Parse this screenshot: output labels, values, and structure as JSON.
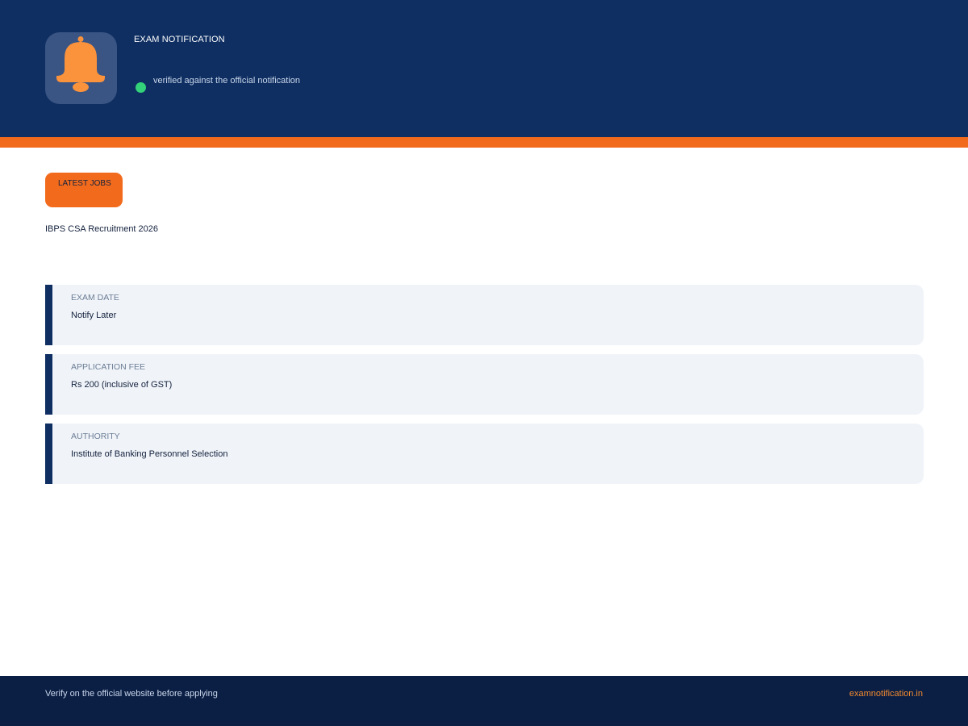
{
  "header": {
    "title": "EXAM NOTIFICATION",
    "icon": "bell-icon",
    "verified_text": "verified against the official notification"
  },
  "badge": {
    "label": "LATEST JOBS"
  },
  "job": {
    "title": "IBPS CSA Recruitment 2026"
  },
  "details": [
    {
      "label": "EXAM DATE",
      "value": "Notify Later"
    },
    {
      "label": "APPLICATION FEE",
      "value": "Rs 200 (inclusive of GST)"
    },
    {
      "label": "AUTHORITY",
      "value": "Institute of Banking Personnel Selection"
    }
  ],
  "footer": {
    "note": "Verify on the official website before applying",
    "site": "examnotification.in"
  },
  "colors": {
    "header_bg": "#0f2f62",
    "accent": "#f26b1d",
    "verified": "#33d17a",
    "card_bg": "#f0f4f9",
    "footer_bg": "#0b1f45"
  }
}
